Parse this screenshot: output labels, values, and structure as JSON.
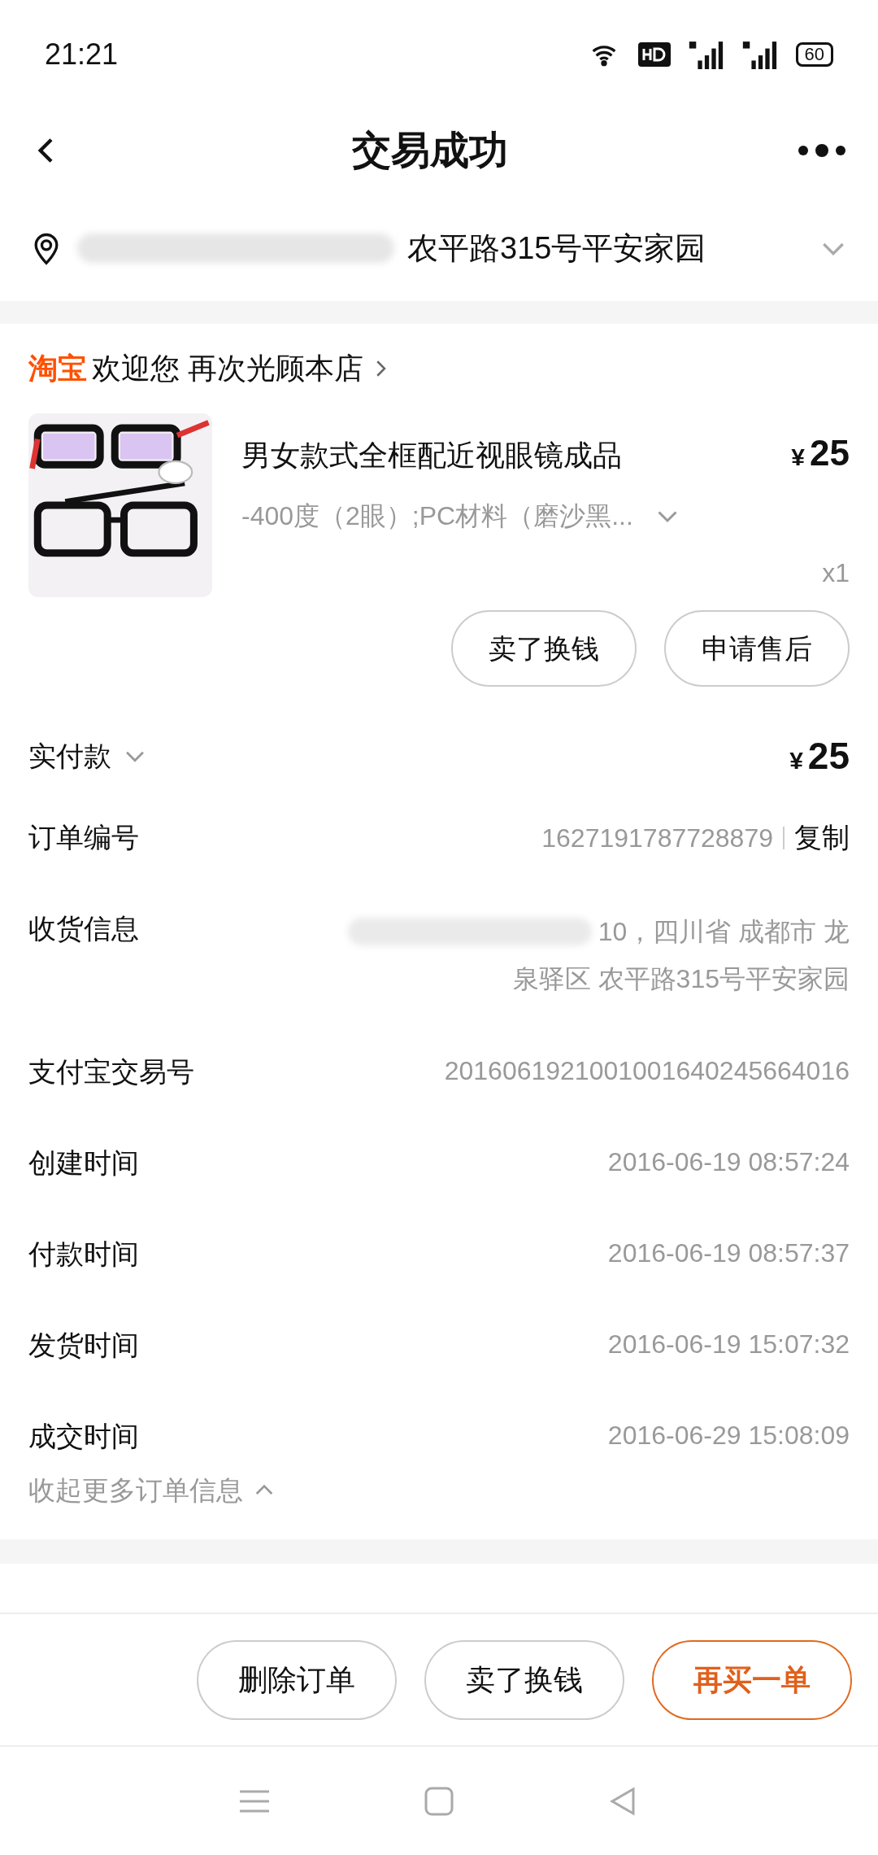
{
  "status_bar": {
    "time": "21:21",
    "battery": "60"
  },
  "nav": {
    "title": "交易成功"
  },
  "address": {
    "text": "农平路315号平安家园"
  },
  "shop": {
    "brand": "淘宝",
    "name": "欢迎您 再次光顾本店"
  },
  "product": {
    "image": {
      "kind": "picture"
    },
    "title": "男女款式全框配近视眼镜成品",
    "currency": "¥",
    "price": "25",
    "sku": "-400度（2眼）;PC材料（磨沙黑...",
    "quantity": "x1",
    "actions": [
      "卖了换钱",
      "申请售后"
    ]
  },
  "payment": {
    "label": "实付款",
    "currency": "¥",
    "amount": "25"
  },
  "order_info": [
    {
      "kind": "copy",
      "label": "订单编号",
      "value": "1627191787728879",
      "action": "复制"
    },
    {
      "kind": "address",
      "label": "收货信息",
      "lines": [
        "10，四川省 成都市 龙",
        "泉驿区 农平路315号平安家园"
      ]
    },
    {
      "kind": "plain",
      "label": "支付宝交易号",
      "value": "2016061921001001640245664016"
    },
    {
      "kind": "plain",
      "label": "创建时间",
      "value": "2016-06-19 08:57:24"
    },
    {
      "kind": "plain",
      "label": "付款时间",
      "value": "2016-06-19 08:57:37"
    },
    {
      "kind": "plain",
      "label": "发货时间",
      "value": "2016-06-19 15:07:32"
    },
    {
      "kind": "plain",
      "label": "成交时间",
      "value": "2016-06-29 15:08:09"
    }
  ],
  "collapse_link": "收起更多订单信息",
  "bottom_actions": [
    {
      "label": "删除订单",
      "primary": false
    },
    {
      "label": "卖了换钱",
      "primary": false
    },
    {
      "label": "再买一单",
      "primary": true
    }
  ]
}
